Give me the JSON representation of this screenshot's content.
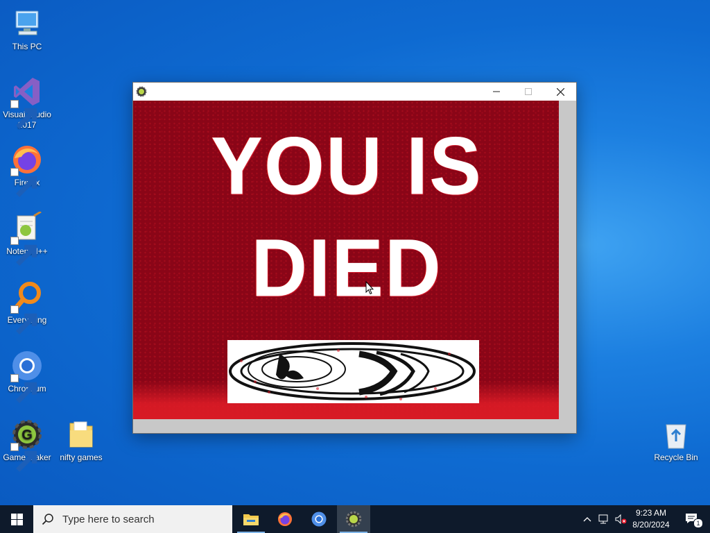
{
  "desktop": {
    "icons": [
      {
        "label": "This PC",
        "icon": "computer-icon"
      },
      {
        "label": "Visual Studio 2017",
        "icon": "visual-studio-icon"
      },
      {
        "label": "Firefox",
        "icon": "firefox-icon"
      },
      {
        "label": "Notepad++",
        "icon": "notepadpp-icon"
      },
      {
        "label": "Everything",
        "icon": "everything-search-icon"
      },
      {
        "label": "Chromium",
        "icon": "chromium-icon"
      },
      {
        "label": "Game Maker",
        "icon": "game-maker-icon"
      },
      {
        "label": "nifty games",
        "icon": "folder-icon"
      },
      {
        "label": "Recycle Bin",
        "icon": "recycle-bin-icon"
      }
    ]
  },
  "game_window": {
    "title": "",
    "app_icon": "game-maker-icon",
    "controls": [
      "minimize",
      "maximize",
      "close"
    ],
    "screen": {
      "headline": "YOU IS DIED",
      "background_color": "#8a0517",
      "image": "troll-face-image"
    }
  },
  "taskbar": {
    "search_placeholder": "Type here to search",
    "pinned": [
      {
        "name": "File Explorer",
        "icon": "file-explorer-icon"
      },
      {
        "name": "Firefox",
        "icon": "firefox-icon"
      },
      {
        "name": "Chromium",
        "icon": "chromium-icon"
      },
      {
        "name": "Game Maker",
        "icon": "game-maker-icon"
      }
    ],
    "tray": {
      "time": "9:23 AM",
      "date": "8/20/2024",
      "notification_count": "1"
    }
  },
  "colors": {
    "taskbar": "#0e1a2b",
    "desktop_accent": "#0e6ad1",
    "game_red": "#8a0517"
  }
}
